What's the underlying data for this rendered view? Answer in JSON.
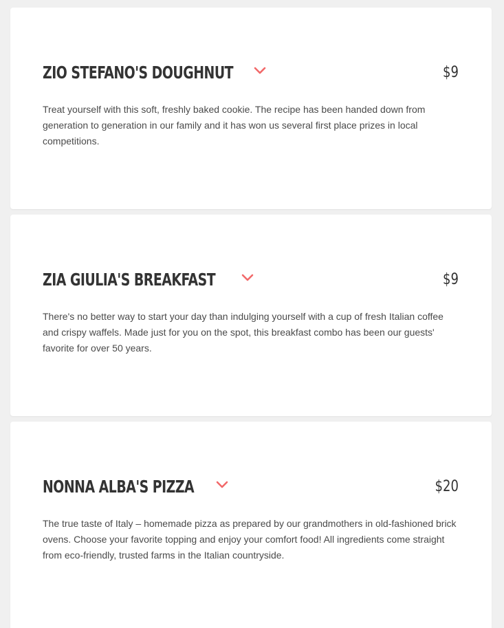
{
  "accent_color": "#f2696a",
  "menu_items": [
    {
      "name": "ZIO STEFANO'S DOUGHNUT",
      "price": "$9",
      "description": "Treat yourself with this soft, freshly baked cookie. The recipe has been handed down from generation to generation in our family and it has won us several first place prizes in local competitions.",
      "toggle_icon": "chevron-down-icon"
    },
    {
      "name": "ZIA GIULIA'S BREAKFAST",
      "price": "$9",
      "description": "There's no better way to start your day than indulging yourself with a cup of fresh Italian coffee and crispy waffels. Made just for you on the spot, this breakfast combo has been our guests' favorite for over 50 years.",
      "toggle_icon": "chevron-down-icon"
    },
    {
      "name": "NONNA ALBA'S PIZZA",
      "price": "$20",
      "description": "The true taste of Italy – homemade pizza as prepared by our grandmothers in old-fashioned brick ovens. Choose your favorite topping and enjoy your comfort food! All ingredients come straight from eco-friendly, trusted farms in the Italian countryside.",
      "toggle_icon": "chevron-down-icon"
    }
  ]
}
